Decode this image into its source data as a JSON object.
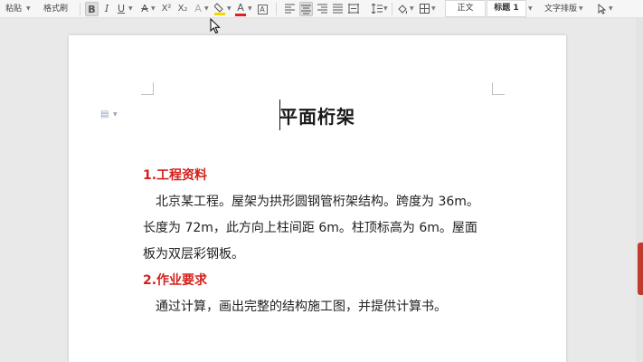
{
  "toolbar": {
    "paste_label": "粘贴",
    "format_painter_label": "格式刷",
    "bold_glyph": "B",
    "italic_glyph": "I",
    "underline_glyph": "U",
    "strikethrough_glyph": "A",
    "superscript_glyph": "X²",
    "subscript_glyph": "X₂",
    "text_effect_glyph": "A",
    "font_color_glyph": "A",
    "char_border_glyph": "A",
    "style_normal_label": "正文",
    "style_heading1_label": "标题 1",
    "text_layout_label": "文字排版",
    "highlight_color": "#f5d800",
    "font_color": "#e02020"
  },
  "document": {
    "title": "平面桁架",
    "section1_heading": "1.工程资料",
    "section1_lines": [
      "北京某工程。屋架为拱形圆钢管桁架结构。跨度为 36m。",
      "长度为 72m，此方向上柱间距 6m。柱顶标高为 6m。屋面",
      "板为双层彩钢板。"
    ],
    "section2_heading": "2.作业要求",
    "section2_lines": [
      "通过计算，画出完整的结构施工图，并提供计算书。"
    ],
    "heading_color": "#d4201a"
  }
}
